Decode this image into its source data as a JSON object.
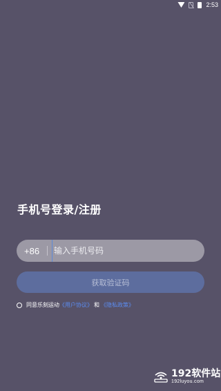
{
  "status_bar": {
    "time": "2:53",
    "icons": [
      "wifi-icon",
      "no-sim-icon",
      "battery-icon"
    ]
  },
  "login": {
    "title": "手机号登录/注册",
    "country_code": "+86",
    "phone_placeholder": "输入手机号码",
    "code_button": "获取验证码",
    "agreement": {
      "prefix": "同意乐刻运动",
      "user_agreement": "《用户协议》",
      "and": "和",
      "privacy_policy": "《隐私政策》"
    }
  },
  "watermark": {
    "title": "192软件站",
    "url": "192luyou.com"
  },
  "colors": {
    "background": "#575268",
    "input_bg": "#9c99a5",
    "button_bg": "#5d6d9e",
    "button_text": "#b8bfd6",
    "link": "#5b8cf0"
  }
}
